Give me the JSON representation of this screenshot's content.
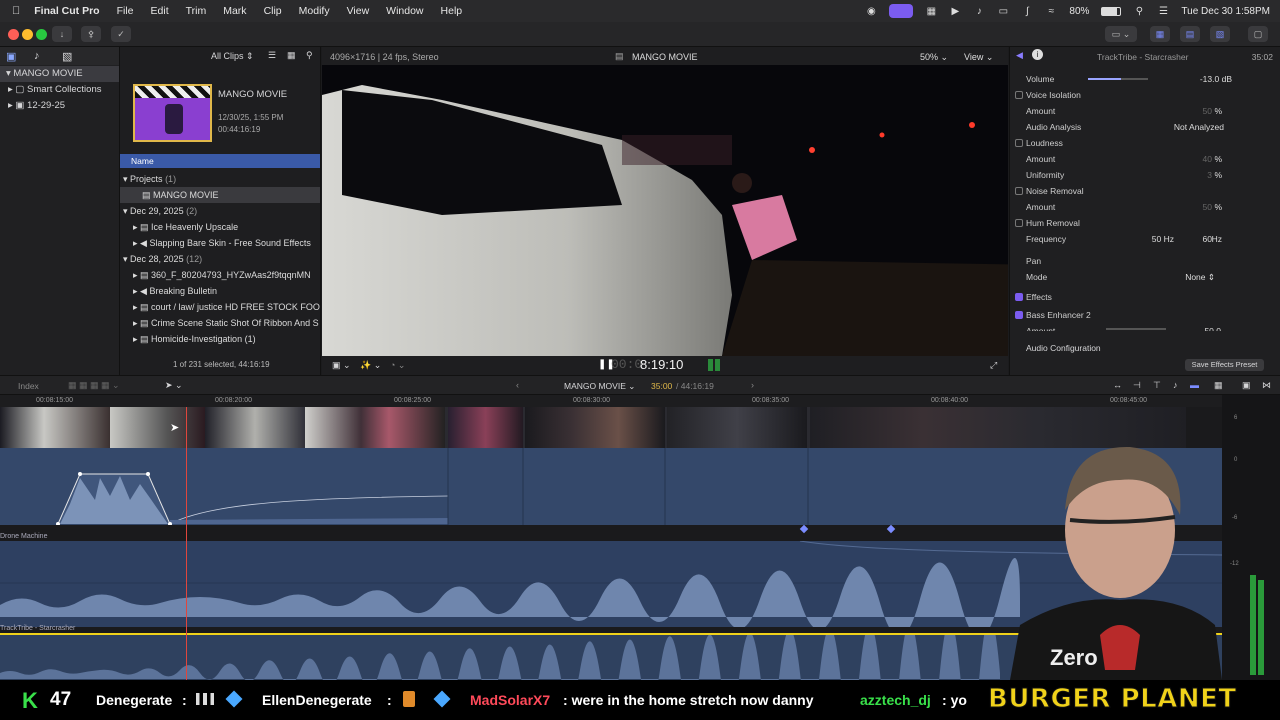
{
  "menubar": {
    "app": "Final Cut Pro",
    "items": [
      "File",
      "Edit",
      "Trim",
      "Mark",
      "Clip",
      "Modify",
      "View",
      "Window",
      "Help"
    ],
    "battery": "80%",
    "clock": "Tue Dec 30  1:58PM"
  },
  "sidebar": {
    "library": "MANGO MOVIE",
    "items": [
      "Smart Collections",
      "12-29-25"
    ]
  },
  "browser": {
    "filter": "All Clips",
    "project_title": "MANGO MOVIE",
    "project_date": "12/30/25, 1:55 PM",
    "project_duration": "00:44:16:19",
    "column_name": "Name",
    "groups": [
      {
        "label": "Projects",
        "count": "(1)"
      },
      {
        "label": "Dec 29, 2025",
        "count": "(2)"
      },
      {
        "label": "Dec 28, 2025",
        "count": "(12)"
      }
    ],
    "project_item": "MANGO MOVIE",
    "dec29_items": [
      "Ice Heavenly Upscale",
      "Slapping Bare Skin - Free Sound Effects"
    ],
    "dec28_items": [
      "360_F_80204793_HYZwAas2f9tqqnMN",
      "Breaking Bulletin",
      "court / law/ justice HD FREE STOCK FOO",
      "Crime Scene Static Shot Of Ribbon And S",
      "Homicide-Investigation (1)"
    ],
    "selection_status": "1 of 231 selected, 44:16:19"
  },
  "viewer": {
    "format": "4096×1716 | 24 fps, Stereo",
    "title": "MANGO MOVIE",
    "zoom": "50%",
    "view_label": "View",
    "timecode": "8:19:10",
    "timecode_prefix": "00:0"
  },
  "inspector": {
    "clip_name": "TrackTribe - Starcrasher",
    "clip_duration": "35:02",
    "volume_label": "Volume",
    "volume_value": "-13.0",
    "volume_unit": "dB",
    "volume_level": 0.55,
    "rows": [
      {
        "type": "check",
        "label": "Voice Isolation"
      },
      {
        "type": "param",
        "label": "Amount",
        "value": "50",
        "unit": "%"
      },
      {
        "type": "param",
        "label": "Audio Analysis",
        "value": "Not Analyzed"
      },
      {
        "type": "check",
        "label": "Loudness"
      },
      {
        "type": "param",
        "label": "Amount",
        "value": "40",
        "unit": "%"
      },
      {
        "type": "param",
        "label": "Uniformity",
        "value": "3",
        "unit": "%"
      },
      {
        "type": "check",
        "label": "Noise Removal"
      },
      {
        "type": "param",
        "label": "Amount",
        "value": "50",
        "unit": "%"
      },
      {
        "type": "check",
        "label": "Hum Removal"
      },
      {
        "type": "param",
        "label": "Frequency",
        "value": "60",
        "unit": "Hz",
        "alt": "50 Hz"
      }
    ],
    "pan_label": "Pan",
    "mode_label": "Mode",
    "mode_value": "None",
    "effects_label": "Effects",
    "effect_name": "Bass Enhancer 2",
    "effect_amount_label": "Amount",
    "effect_amount_value": "50.0",
    "audio_config": "Audio Configuration",
    "save_preset": "Save Effects Preset"
  },
  "timeline": {
    "index_label": "Index",
    "project": "MANGO MOVIE",
    "position": "35:00",
    "total": "44:16:19",
    "ruler": [
      "00:08:15:00",
      "00:08:20:00",
      "00:08:25:00",
      "00:08:30:00",
      "00:08:35:00",
      "00:08:40:00",
      "00:08:45:00"
    ],
    "track1_label": "Drone Machine",
    "track2_label": "TrackTribe - Starcrasher",
    "meter_labels": [
      "6",
      "0",
      "-6",
      "-12"
    ]
  },
  "ticker": {
    "k_count": "47",
    "chat": [
      {
        "user": "Denegerate",
        "msg": ""
      },
      {
        "user": "EllenDenegerate",
        "msg": ""
      },
      {
        "user": "MadSolarX7",
        "msg": "were in the home stretch now danny"
      },
      {
        "user": "azztech_dj",
        "msg": "yo"
      }
    ],
    "brand": "BURGER PLANET"
  },
  "colors": {
    "accent": "#7b5cf0",
    "playhead": "#e0463d",
    "track_blue": "#34486a",
    "ticker_yellow": "#f0d21a",
    "ticker_green": "#39e04a"
  }
}
